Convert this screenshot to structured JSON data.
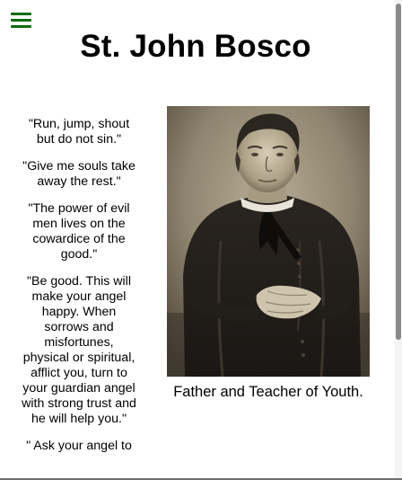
{
  "header": {
    "menu_icon": "hamburger-menu-icon",
    "menu_color": "#0a6b0a",
    "title": "St. John Bosco"
  },
  "quotes": [
    "\"Run, jump, shout but do not sin.\"",
    "\"Give me souls take away the rest.\"",
    "\"The power of evil men lives on the cowardice of the good.\"",
    "\"Be good. This will make your angel happy. When sorrows and misfortunes, physical or spiritual, afflict you, turn to your guardian angel with strong trust and he will help you.\"",
    "\" Ask your angel to"
  ],
  "portrait": {
    "caption": "Father and Teacher of Youth."
  }
}
